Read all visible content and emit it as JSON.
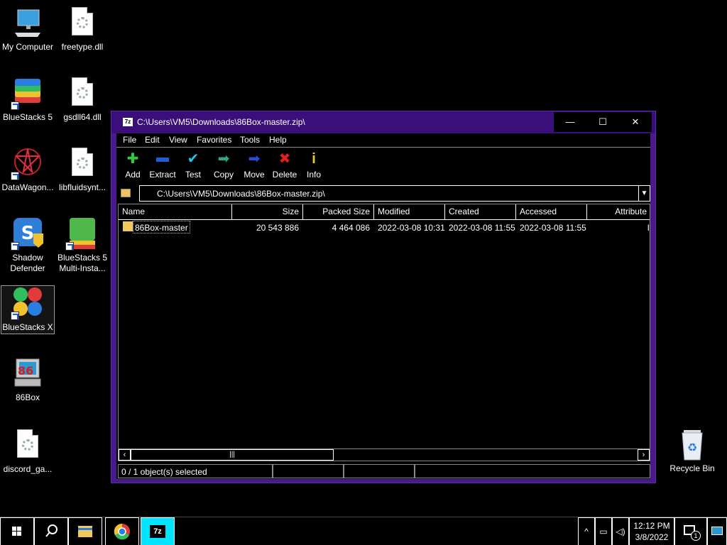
{
  "desktop": {
    "icons": [
      {
        "label": "My Computer"
      },
      {
        "label": "freetype.dll"
      },
      {
        "label": "BlueStacks 5"
      },
      {
        "label": "gsdll64.dll"
      },
      {
        "label": "DataWagon..."
      },
      {
        "label": "libfluidsynt..."
      },
      {
        "label": "Shadow Defender"
      },
      {
        "label": "BlueStacks 5 Multi-Insta..."
      },
      {
        "label": "BlueStacks X"
      },
      {
        "label": "86Box"
      },
      {
        "label": "discord_ga..."
      },
      {
        "label": "Recycle Bin"
      }
    ]
  },
  "window": {
    "icon_text": "7z",
    "title": "C:\\Users\\VM5\\Downloads\\86Box-master.zip\\",
    "minimize": "—",
    "maximize": "☐",
    "close": "✕"
  },
  "menu": [
    "File",
    "Edit",
    "View",
    "Favorites",
    "Tools",
    "Help"
  ],
  "toolbar": {
    "add": "Add",
    "extract": "Extract",
    "test": "Test",
    "copy": "Copy",
    "move": "Move",
    "delete": "Delete",
    "info": "Info"
  },
  "address": {
    "path": "C:\\Users\\VM5\\Downloads\\86Box-master.zip\\"
  },
  "columns": [
    "Name",
    "Size",
    "Packed Size",
    "Modified",
    "Created",
    "Accessed",
    "Attribute"
  ],
  "rows": [
    {
      "name": "86Box-master",
      "size": "20 543 886",
      "packed": "4 464 086",
      "modified": "2022-03-08 10:31",
      "created": "2022-03-08 11:55",
      "accessed": "2022-03-08 11:55",
      "attribute": "I"
    }
  ],
  "status": {
    "selected": "0 / 1 object(s) selected"
  },
  "taskbar": {
    "time": "12:12 PM",
    "date": "3/8/2022",
    "notifications": "1",
    "sevenzip_label": "7z"
  },
  "colors": {
    "window_frame": "#4a1a8c",
    "titlebar": "#3a0f7a",
    "taskbar_active": "#00e5ff"
  }
}
